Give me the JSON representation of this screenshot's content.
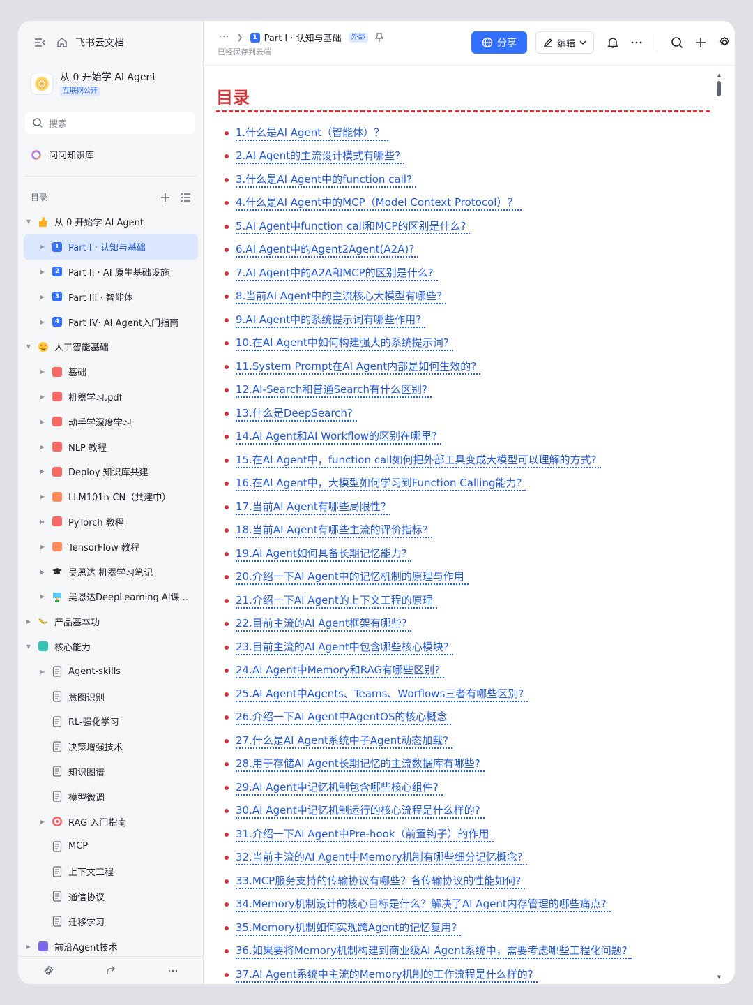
{
  "sidebar": {
    "brand": "飞书云文档",
    "space_title": "从 0 开始学 AI Agent",
    "space_badge": "互联网公开",
    "search_placeholder": "搜索",
    "ask_kb": "问问知识库",
    "toc_label": "目录",
    "tree": [
      {
        "label": "从 0 开始学 AI Agent",
        "level": 0,
        "arrow": "down",
        "icon": "thumbs-up-icon"
      },
      {
        "label": "Part I · 认知与基础",
        "level": 1,
        "arrow": "right",
        "icon": "num",
        "num": "1",
        "active": true
      },
      {
        "label": "Part II · AI 原生基础设施",
        "level": 1,
        "arrow": "right",
        "icon": "num",
        "num": "2"
      },
      {
        "label": "Part III · 智能体",
        "level": 1,
        "arrow": "right",
        "icon": "num",
        "num": "3"
      },
      {
        "label": "Part IV· AI Agent入门指南",
        "level": 1,
        "arrow": "right",
        "icon": "num",
        "num": "4"
      },
      {
        "label": "人工智能基础",
        "level": 0,
        "arrow": "down",
        "icon": "smile-heart-icon"
      },
      {
        "label": "基础",
        "level": 1,
        "arrow": "right",
        "icon": "red"
      },
      {
        "label": "机器学习.pdf",
        "level": 1,
        "arrow": "right",
        "icon": "red"
      },
      {
        "label": "动手学深度学习",
        "level": 1,
        "arrow": "right",
        "icon": "red"
      },
      {
        "label": "NLP 教程",
        "level": 1,
        "arrow": "right",
        "icon": "red"
      },
      {
        "label": "Deploy 知识库共建",
        "level": 1,
        "arrow": "right",
        "icon": "red"
      },
      {
        "label": "LLM101n-CN（共建中）",
        "level": 1,
        "arrow": "right",
        "icon": "orange"
      },
      {
        "label": "PyTorch 教程",
        "level": 1,
        "arrow": "right",
        "icon": "red"
      },
      {
        "label": "TensorFlow 教程",
        "level": 1,
        "arrow": "right",
        "icon": "orange"
      },
      {
        "label": "吴恩达 机器学习笔记",
        "level": 1,
        "arrow": "right",
        "icon": "grad-cap-icon"
      },
      {
        "label": "吴恩达DeepLearning.AI课...",
        "level": 1,
        "arrow": "right",
        "icon": "teacher-icon"
      },
      {
        "label": "产品基本功",
        "level": 0,
        "arrow": "right",
        "icon": "banana-icon"
      },
      {
        "label": "核心能力",
        "level": 0,
        "arrow": "down",
        "icon": "teal"
      },
      {
        "label": "Agent-skills",
        "level": 1,
        "arrow": "right",
        "icon": "doc"
      },
      {
        "label": "意图识别",
        "level": 1,
        "arrow": "",
        "icon": "doc"
      },
      {
        "label": "RL-强化学习",
        "level": 1,
        "arrow": "",
        "icon": "doc"
      },
      {
        "label": "决策增强技术",
        "level": 1,
        "arrow": "",
        "icon": "doc"
      },
      {
        "label": "知识图谱",
        "level": 1,
        "arrow": "",
        "icon": "doc"
      },
      {
        "label": "模型微调",
        "level": 1,
        "arrow": "",
        "icon": "doc"
      },
      {
        "label": "RAG 入门指南",
        "level": 1,
        "arrow": "right",
        "icon": "target-icon"
      },
      {
        "label": "MCP",
        "level": 1,
        "arrow": "",
        "icon": "doc"
      },
      {
        "label": "上下文工程",
        "level": 1,
        "arrow": "",
        "icon": "doc"
      },
      {
        "label": "通信协议",
        "level": 1,
        "arrow": "",
        "icon": "doc"
      },
      {
        "label": "迁移学习",
        "level": 1,
        "arrow": "",
        "icon": "doc"
      },
      {
        "label": "前沿Agent技术",
        "level": 0,
        "arrow": "right",
        "icon": "purple"
      }
    ]
  },
  "header": {
    "breadcrumb_dots": "···",
    "breadcrumb_page": "Part I · 认知与基础",
    "breadcrumb_num": "1",
    "external_badge": "外部",
    "saved_status": "已经保存到云端",
    "share_label": "分享",
    "edit_label": "编辑"
  },
  "doc": {
    "title": "目录",
    "items": [
      "1.什么是AI Agent（智能体）？",
      "2.AI Agent的主流设计模式有哪些?",
      "3.什么是AI Agent中的function call?",
      "4.什么是AI Agent中的MCP（Model Context Protocol）？",
      "5.AI Agent中function call和MCP的区别是什么?",
      "6.AI Agent中的Agent2Agent(A2A)?",
      "7.AI Agent中的A2A和MCP的区别是什么?",
      "8.当前AI Agent中的主流核心大模型有哪些?",
      "9.AI Agent中的系统提示词有哪些作用?",
      "10.在AI Agent中如何构建强大的系统提示词?",
      "11.System Prompt在AI Agent内部是如何生效的?",
      "12.AI-Search和普通Search有什么区别?",
      "13.什么是DeepSearch?",
      "14.AI Agent和AI Workflow的区别在哪里?",
      "15.在AI Agent中，function call如何把外部工具变成大模型可以理解的方式?",
      "16.在AI Agent中，大模型如何学习到Function Calling能力?",
      "17.当前AI Agent有哪些局限性?",
      "18.当前AI Agent有哪些主流的评价指标?",
      "19.AI Agent如何具备长期记忆能力?",
      "20.介绍一下AI Agent中的记忆机制的原理与作用",
      "21.介绍一下AI Agent的上下文工程的原理",
      "22.目前主流的AI Agent框架有哪些?",
      "23.目前主流的AI Agent中包含哪些核心模块?",
      "24.AI Agent中Memory和RAG有哪些区别?",
      "25.AI Agent中Agents、Teams、Worflows三者有哪些区别?",
      "26.介绍一下AI Agent中AgentOS的核心概念",
      "27.什么是AI Agent系统中子Agent动态加载?",
      "28.用于存储AI Agent长期记忆的主流数据库有哪些?",
      "29.AI Agent中记忆机制包含哪些核心组件?",
      "30.AI Agent中记忆机制运行的核心流程是什么样的?",
      "31.介绍一下AI Agent中Pre-hook（前置钩子）的作用",
      "32.当前主流的AI Agent中Memory机制有哪些细分记忆概念?",
      "33.MCP服务支持的传输协议有哪些？各传输协议的性能如何?",
      "34.Memory机制设计的核心目标是什么？解决了AI Agent内存管理的哪些痛点?",
      "35.Memory机制如何实现跨Agent的记忆复用?",
      "36.如果要将Memory机制构建到商业级AI Agent系统中，需要考虑哪些工程化问题?",
      "37.AI Agent系统中主流的Memory机制的工作流程是什么样的?"
    ]
  },
  "colors": {
    "accent": "#3370ff",
    "title_red": "#d13438",
    "link_blue": "#245bdb",
    "sidebar_bg": "#f5f6f7"
  }
}
